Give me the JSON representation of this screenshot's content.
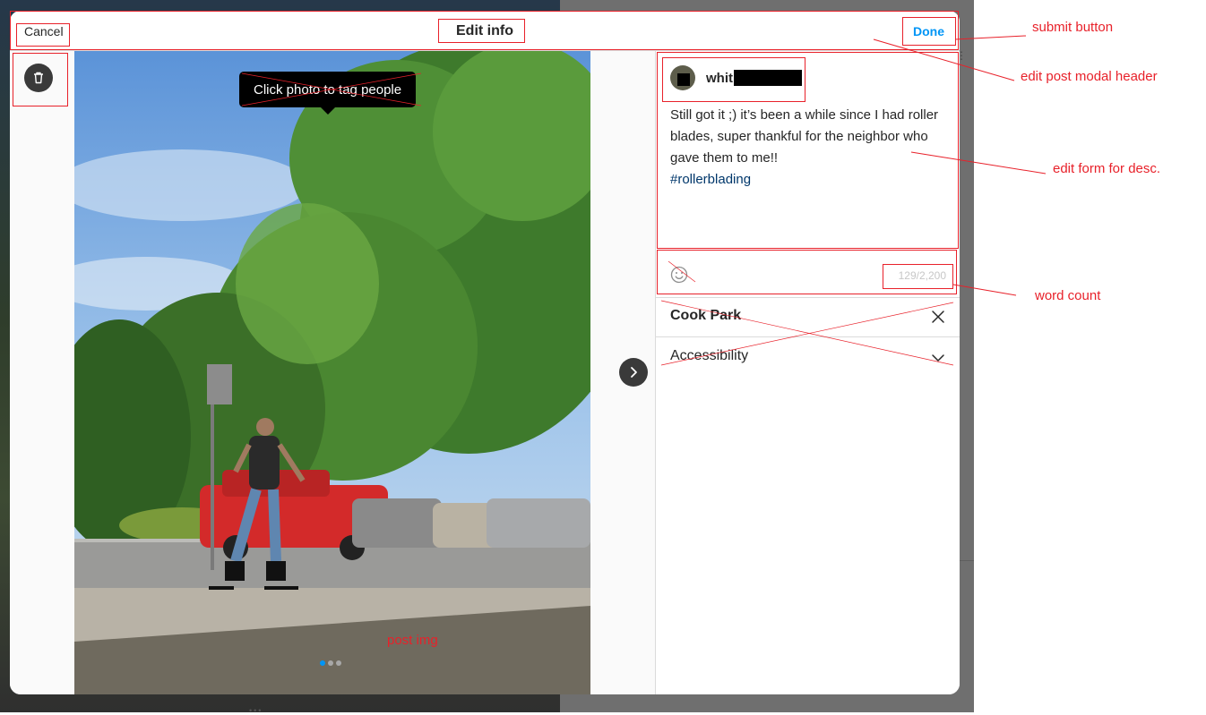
{
  "modal": {
    "header": {
      "cancel_label": "Cancel",
      "title": "Edit info",
      "done_label": "Done"
    },
    "photo": {
      "tag_tooltip": "Click photo to tag people",
      "carousel": {
        "count": 3,
        "active_index": 0
      }
    },
    "side_panel": {
      "author": {
        "username_visible": "whit"
      },
      "caption": {
        "text": "Still got it ;) it’s been a while since I had roller blades, super thankful for the neighbor who gave them to me!!",
        "hashtag": "#rollerblading"
      },
      "char_count": "129/2,200",
      "location": "Cook Park",
      "accessibility_label": "Accessibility"
    },
    "icons": {
      "delete": "trash-icon",
      "next": "chevron-right-icon",
      "emoji": "smiley-icon",
      "clear": "close-icon",
      "expand": "chevron-down-icon"
    }
  },
  "annotations": {
    "submit_button": "submit button",
    "modal_header": "edit post modal header",
    "desc_form": "edit form for desc.",
    "word_count": "word count",
    "post_img": "post img"
  },
  "colors": {
    "accent": "#0095f6",
    "annotation": "#e8212a",
    "hashtag": "#00376b"
  }
}
